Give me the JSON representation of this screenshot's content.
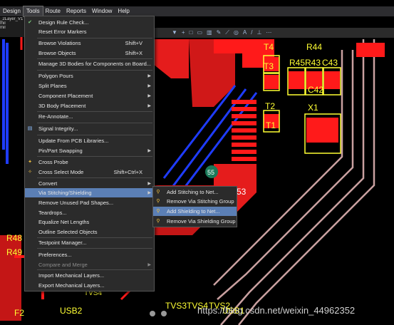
{
  "menubar": [
    {
      "label": "Design",
      "active": false
    },
    {
      "label": "Tools",
      "active": true
    },
    {
      "label": "Route",
      "active": false
    },
    {
      "label": "Reports",
      "active": false
    },
    {
      "label": "Window",
      "active": false
    },
    {
      "label": "Help",
      "active": false
    }
  ],
  "doc_tab": {
    "title": "_2Layer_V1",
    "lines": [
      "mil",
      "mil"
    ]
  },
  "tools_menu": [
    {
      "label": "Design Rule Check...",
      "icon": "drc-check-icon"
    },
    {
      "label": "Reset Error Markers"
    },
    {
      "sep": true
    },
    {
      "label": "Browse Violations",
      "shortcut": "Shift+V"
    },
    {
      "label": "Browse Objects",
      "shortcut": "Shift+X"
    },
    {
      "sep": true
    },
    {
      "label": "Manage 3D Bodies for Components on Board..."
    },
    {
      "sep": true
    },
    {
      "label": "Polygon Pours",
      "submenu": true
    },
    {
      "label": "Split Planes",
      "submenu": true
    },
    {
      "label": "Component Placement",
      "submenu": true
    },
    {
      "label": "3D Body Placement",
      "submenu": true
    },
    {
      "sep": true
    },
    {
      "label": "Re-Annotate..."
    },
    {
      "sep": true
    },
    {
      "label": "Signal Integrity...",
      "icon": "signal-integrity-icon"
    },
    {
      "sep": true
    },
    {
      "label": "Update From PCB Libraries..."
    },
    {
      "label": "Pin/Part Swapping",
      "submenu": true
    },
    {
      "sep": true
    },
    {
      "label": "Cross Probe",
      "icon": "cross-probe-icon"
    },
    {
      "label": "Cross Select Mode",
      "shortcut": "Shift+Ctrl+X",
      "icon": "cross-select-icon"
    },
    {
      "sep": true
    },
    {
      "label": "Convert",
      "submenu": true
    },
    {
      "label": "Via Stitching/Shielding",
      "submenu": true,
      "highlighted": true
    },
    {
      "label": "Remove Unused Pad Shapes..."
    },
    {
      "label": "Teardrops..."
    },
    {
      "label": "Equalize Net Lengths"
    },
    {
      "label": "Outline Selected Objects"
    },
    {
      "sep": true
    },
    {
      "label": "Testpoint Manager..."
    },
    {
      "sep": true
    },
    {
      "label": "Preferences..."
    },
    {
      "label": "Compare and Merge",
      "submenu": true,
      "disabled": true
    },
    {
      "sep": true
    },
    {
      "label": "Import Mechanical Layers..."
    },
    {
      "label": "Export Mechanical Layers..."
    }
  ],
  "via_submenu": [
    {
      "label": "Add Stitching to Net...",
      "icon": "via-icon"
    },
    {
      "label": "Remove Via Stitching Group",
      "icon": "via-icon"
    },
    {
      "label": "Add Shielding to Net...",
      "icon": "via-icon",
      "highlighted": true
    },
    {
      "label": "Remove Via Shielding Group",
      "icon": "via-icon"
    }
  ],
  "pcb_labels": [
    "T4",
    "T3",
    "T2",
    "T1",
    "R45",
    "R43",
    "C43",
    "R44",
    "C42",
    "X1",
    "55",
    "53",
    "R48",
    "R49",
    "F2",
    "USB2",
    "TVS3",
    "TVS4",
    "TVS2",
    "USB1",
    "TVS4"
  ],
  "toolbar_icons": [
    "filter-icon",
    "add-icon",
    "select-icon",
    "rect-icon",
    "chart-icon",
    "draw-icon",
    "route-icon",
    "via-icon",
    "text-icon",
    "line-icon",
    "dimension-icon",
    "more-icon"
  ],
  "watermark": "https://blog.csdn.net/weixin_44962352",
  "colors": {
    "menu_bg": "#2b2b2b",
    "highlight": "#5b7fb5",
    "track_red": "#ff1a1a",
    "track_blue": "#1f3cff",
    "silk_yellow": "#ffff33"
  }
}
